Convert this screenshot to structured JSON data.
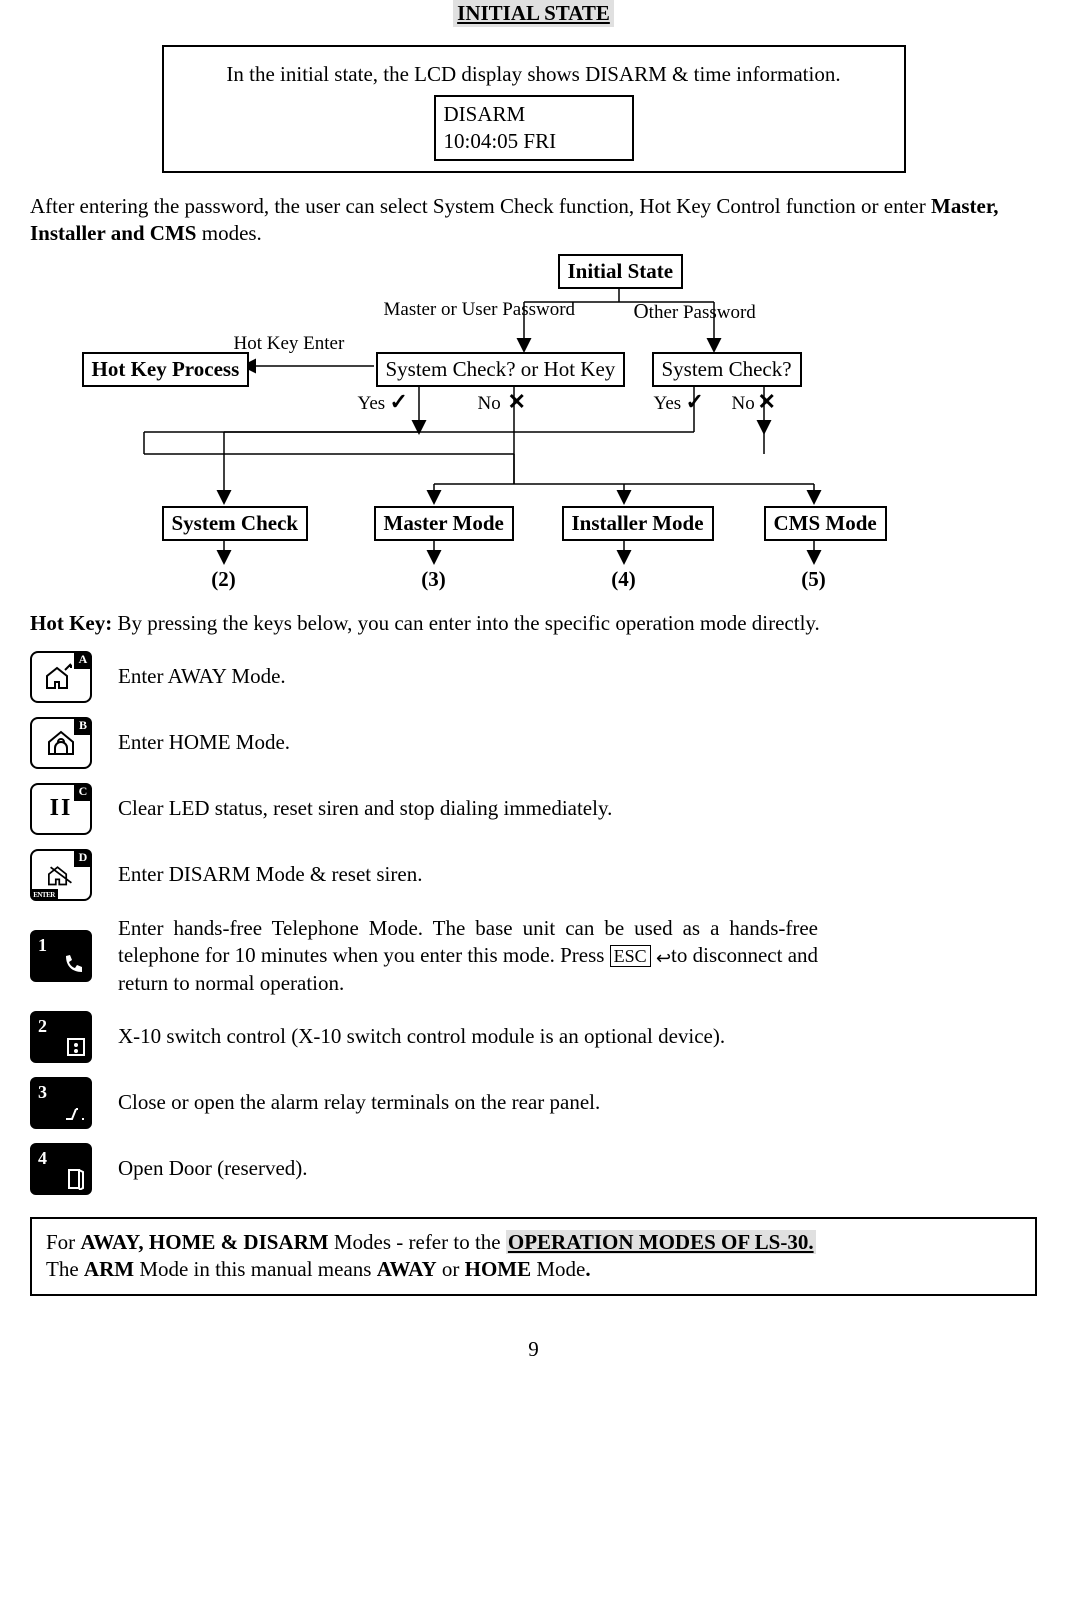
{
  "title": "INITIAL STATE",
  "outer_box_text": "In the initial state, the LCD display shows DISARM & time information.",
  "lcd": {
    "line1": "DISARM",
    "line2": "10:04:05    FRI"
  },
  "para1_a": "After entering the password, the user can select System Check function, Hot Key Control function or enter ",
  "para1_b": "Master, Installer and CMS",
  "para1_c": " modes.",
  "diagram": {
    "initial_state": "Initial State",
    "master_or_user_pw": "Master or User Password",
    "other_pw": "Other Password",
    "hot_key_enter": "Hot Key Enter",
    "hot_key_process": "Hot Key Process",
    "syscheck_or_hotkey": "System Check? or Hot Key",
    "syscheck_q": "System Check?",
    "yes": "Yes",
    "no": "No",
    "system_check": "System Check",
    "master_mode": "Master Mode",
    "installer_mode": "Installer Mode",
    "cms_mode": "CMS Mode",
    "n2": "(2)",
    "n3": "(3)",
    "n4": "(4)",
    "n5": "(5)"
  },
  "hotkey_intro_b": "Hot Key:",
  "hotkey_intro": " By pressing the keys below, you can enter into the specific operation mode directly.",
  "keys": {
    "a": "A",
    "b": "B",
    "c": "C",
    "d": "D",
    "enter": "ENTER",
    "k1": "1",
    "k2": "2",
    "k3": "3",
    "k4": "4"
  },
  "desc": {
    "away": "Enter AWAY Mode.",
    "home": "Enter HOME Mode.",
    "clear": "Clear LED status, reset siren and stop dialing immediately.",
    "disarm": "Enter DISARM Mode & reset siren.",
    "phone_a": "Enter hands-free Telephone Mode. The base unit can be used as a hands-free telephone for 10 minutes when you enter this mode. Press ",
    "phone_esc": "ESC",
    "phone_b": "to disconnect and return to normal operation.",
    "x10": "X-10 switch control (X-10 switch control module is an optional device).",
    "relay": "Close or open the alarm relay terminals on the rear panel.",
    "door": "Open Door (reserved)."
  },
  "note": {
    "a": "For ",
    "b": "AWAY, HOME & DISARM",
    "c": " Modes - refer to the ",
    "d": "OPERATION MODES OF LS-30. ",
    "e": "The ",
    "f": "ARM",
    "g": " Mode in this manual means ",
    "h": "AWAY",
    "i": " or ",
    "j": "HOME",
    "k": " Mode",
    "l": "."
  },
  "page_number": "9"
}
